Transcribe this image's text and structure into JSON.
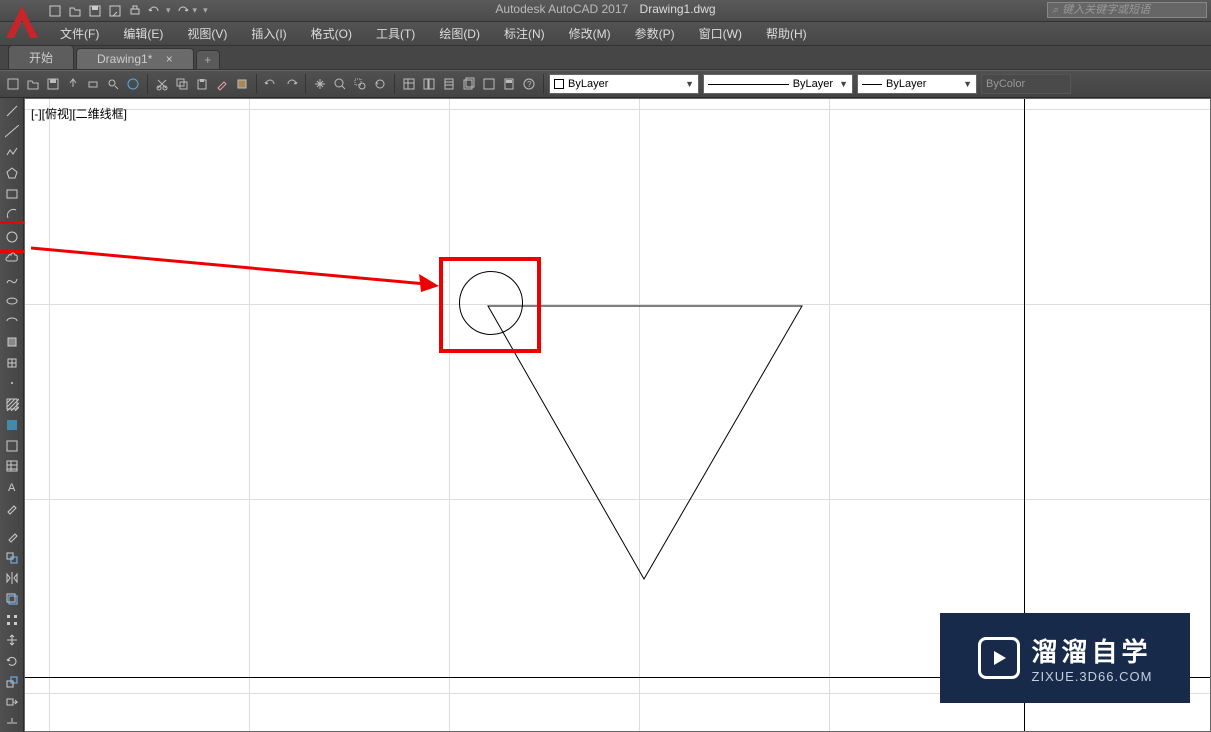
{
  "app": {
    "title": "Autodesk AutoCAD 2017",
    "filename": "Drawing1.dwg"
  },
  "search": {
    "placeholder": "键入关键字或短语"
  },
  "menus": [
    "文件(F)",
    "编辑(E)",
    "视图(V)",
    "插入(I)",
    "格式(O)",
    "工具(T)",
    "绘图(D)",
    "标注(N)",
    "修改(M)",
    "参数(P)",
    "窗口(W)",
    "帮助(H)"
  ],
  "tabs": {
    "start": "开始",
    "drawing": "Drawing1*",
    "add": "+"
  },
  "props": {
    "layer": "ByLayer",
    "linetype": "ByLayer",
    "lineweight": "ByLayer",
    "bycolor": "ByColor"
  },
  "viewport": {
    "label": "[-][俯视][二维线框]"
  },
  "watermark": {
    "title": "溜溜自学",
    "url": "ZIXUE.3D66.COM"
  }
}
